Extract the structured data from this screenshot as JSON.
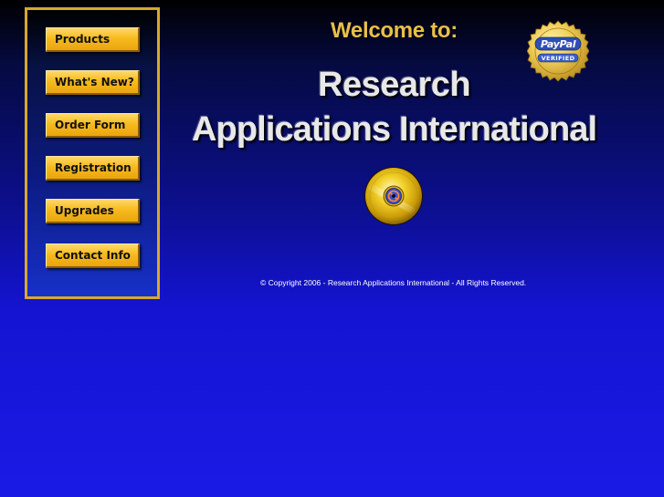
{
  "nav": {
    "items": [
      {
        "label": "Products"
      },
      {
        "label": "What's New?"
      },
      {
        "label": "Order Form"
      },
      {
        "label": "Registration"
      },
      {
        "label": "Upgrades"
      },
      {
        "label": "Contact Info"
      }
    ]
  },
  "header": {
    "welcome": "Welcome to:",
    "title_line_1": "Research",
    "title_line_2": "Applications International"
  },
  "paypal_seal": {
    "brand": "PayPal",
    "status": "VERIFIED",
    "icon": "paypal-verified-seal-icon"
  },
  "logo": {
    "icon": "cd-disc-icon"
  },
  "footer": {
    "copyright": "© Copyright 2006 - Research Applications International - All Rights Reserved."
  },
  "colors": {
    "accent_gold": "#f7bb1e",
    "border_gold": "#d8a82c",
    "background_blue": "#1a1ae6",
    "welcome_gold": "#e9bf4a"
  }
}
